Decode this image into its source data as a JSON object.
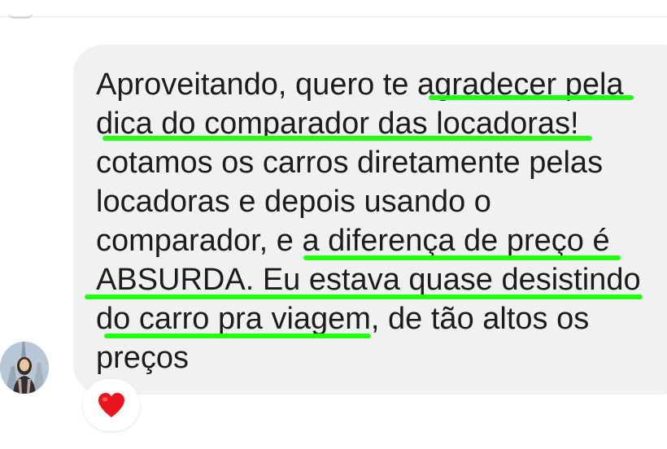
{
  "message": {
    "lines": [
      "Aproveitando, quero te agradecer pela",
      "dica do comparador das locadoras!",
      "cotamos os carros diretamente pelas",
      "locadoras e depois usando o",
      "comparador, e a diferença de preço é",
      "ABSURDA. Eu estava quase desistindo",
      "do carro pra viagem, de tão altos os",
      "preços"
    ],
    "highlight_color": "#22ff11",
    "bubble_color": "#f0f1f3"
  },
  "reaction": {
    "icon": "heart-icon",
    "color": "#e8141f"
  },
  "avatar": {
    "icon": "profile-photo"
  }
}
